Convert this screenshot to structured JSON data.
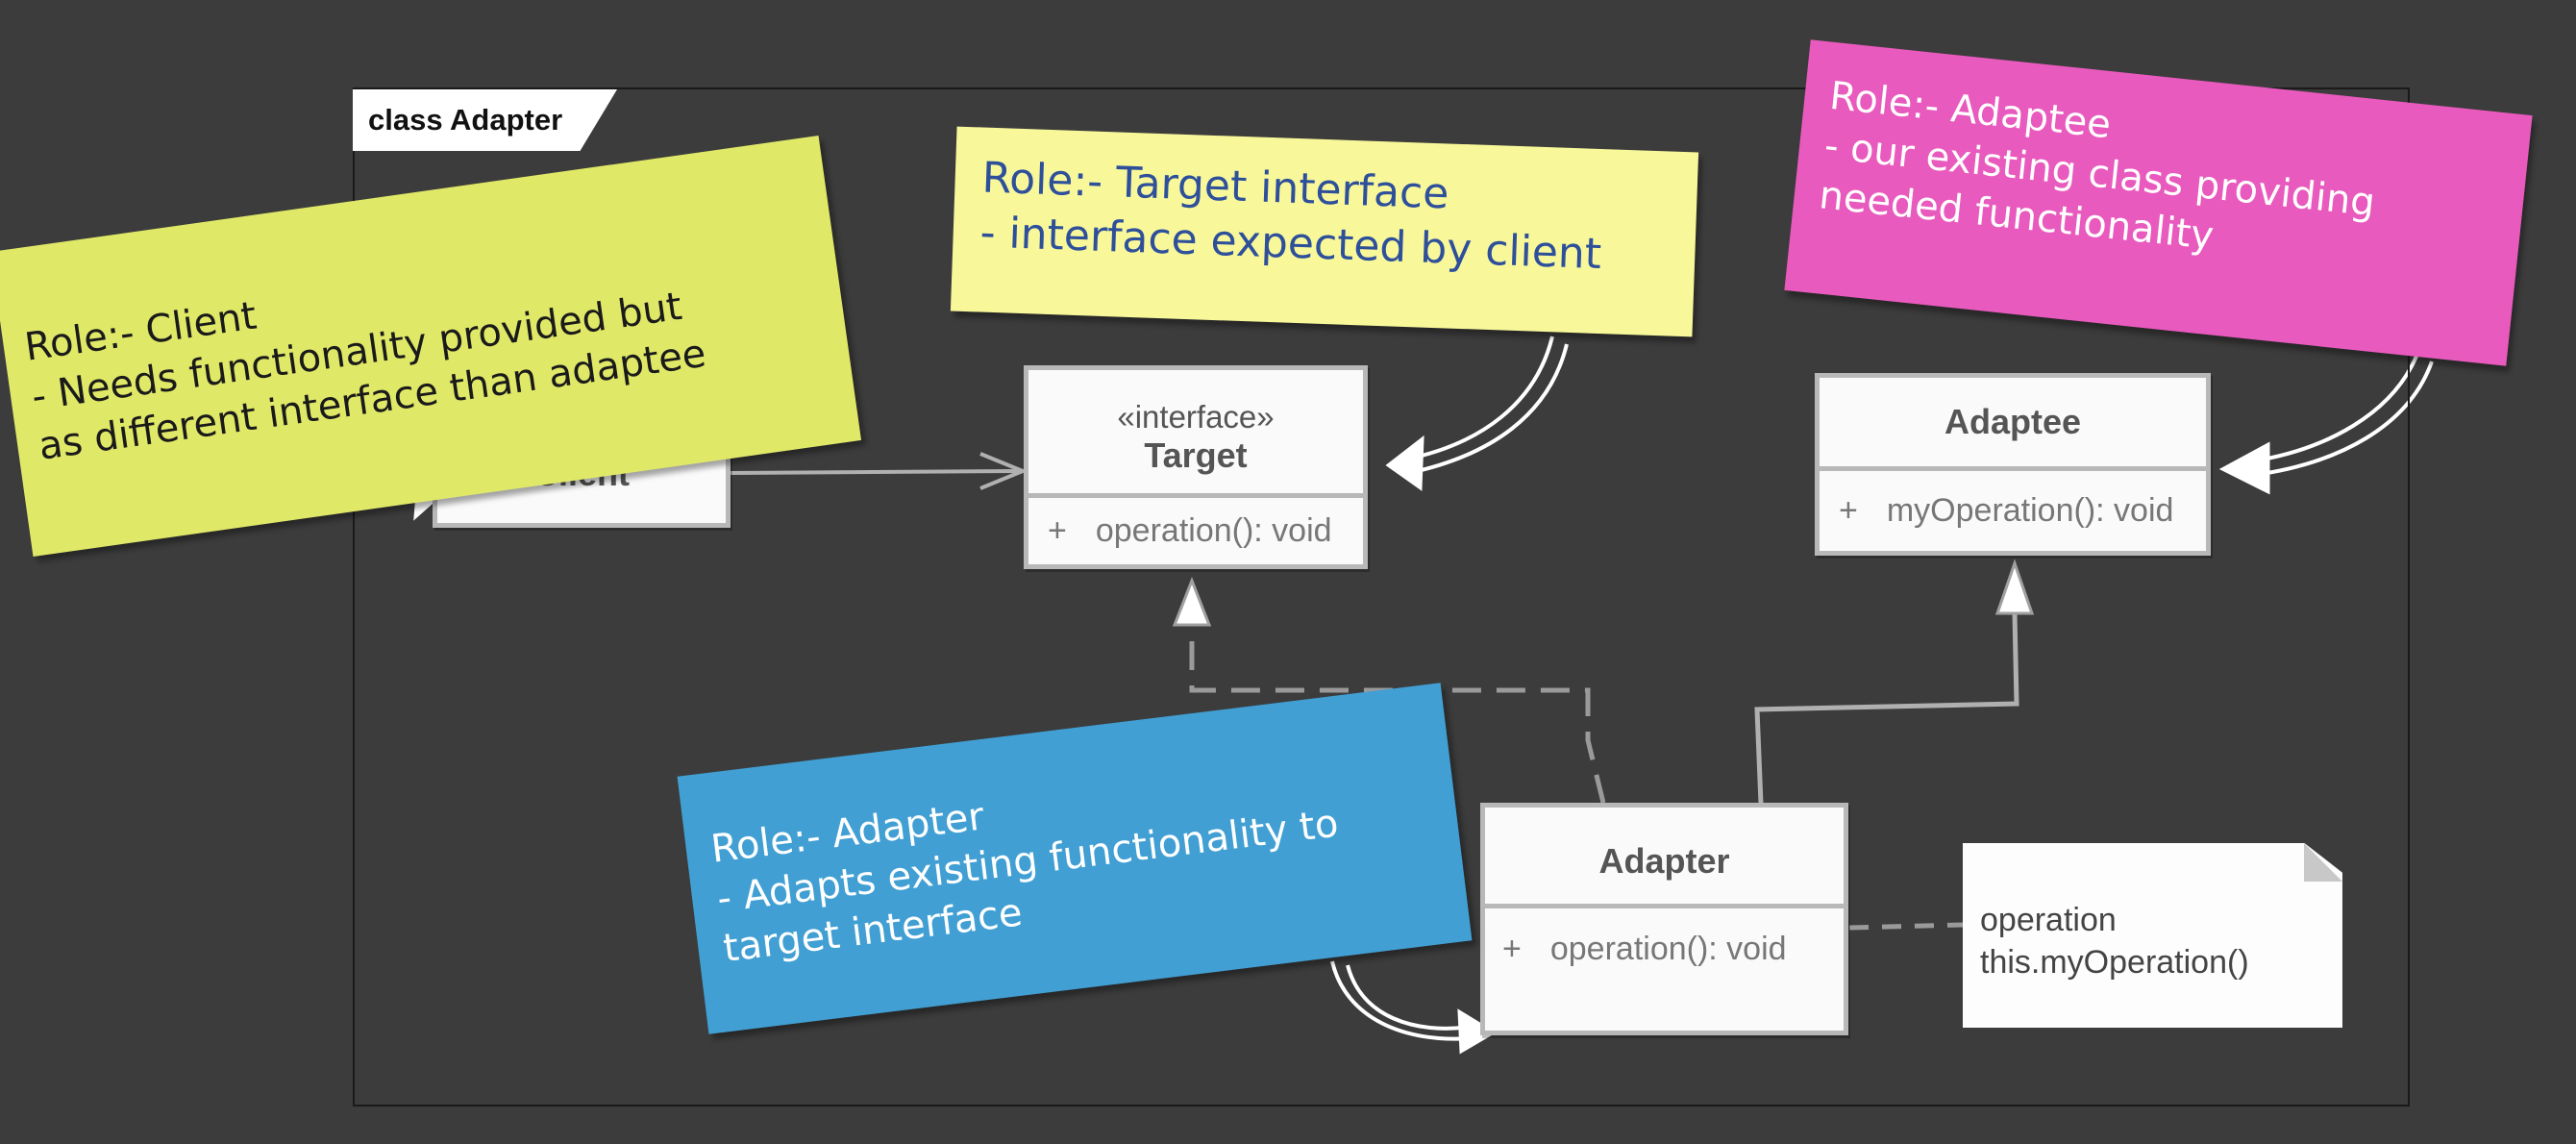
{
  "frame": {
    "title": "class Adapter"
  },
  "classes": {
    "client": {
      "name": "Client"
    },
    "target": {
      "stereotype": "«interface»",
      "name": "Target",
      "visibility": "+",
      "operation": "operation(): void"
    },
    "adaptee": {
      "name": "Adaptee",
      "visibility": "+",
      "operation": "myOperation(): void"
    },
    "adapter": {
      "name": "Adapter",
      "visibility": "+",
      "operation": "operation(): void"
    }
  },
  "note": {
    "lines": [
      "operation",
      "this.myOperation()"
    ]
  },
  "stickies": {
    "client": {
      "color": "#e0e868",
      "lines": [
        "Role:- Client",
        "- Needs functionality provided but",
        "as different interface than adaptee"
      ]
    },
    "target": {
      "color": "#f8f89a",
      "lines": [
        "Role:- Target interface",
        "- interface expected by client"
      ]
    },
    "adaptee": {
      "color": "#e85abd",
      "lines": [
        "Role:- Adaptee",
        "- our existing class providing",
        "needed functionality"
      ]
    },
    "adapter": {
      "color": "#419fd3",
      "lines": [
        "Role:- Adapter",
        "- Adapts existing functionality to",
        "target interface"
      ]
    }
  }
}
